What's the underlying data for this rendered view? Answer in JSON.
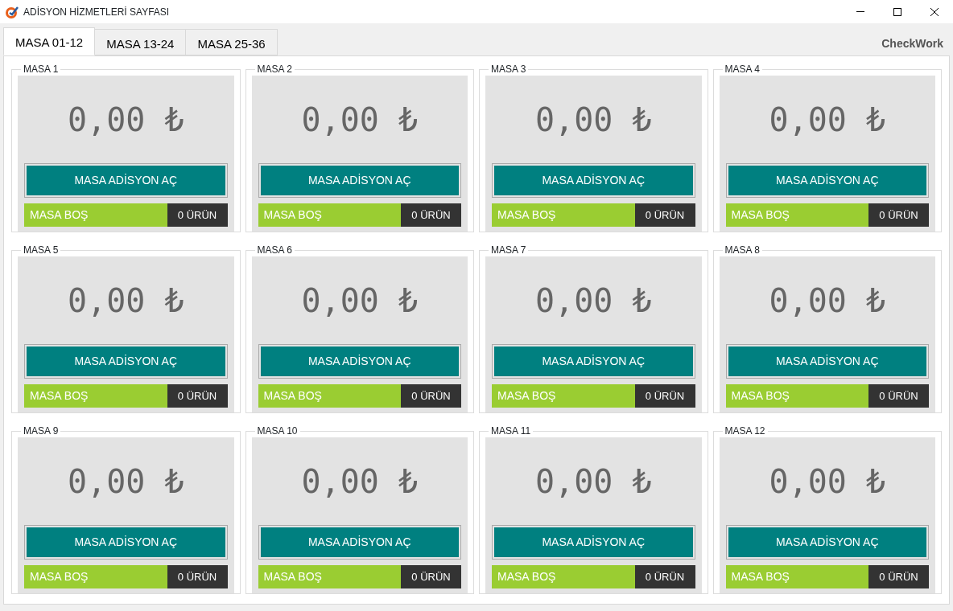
{
  "window": {
    "title": "ADİSYON HİZMETLERİ SAYFASI"
  },
  "tabs": [
    {
      "label": "MASA 01-12",
      "selected": true
    },
    {
      "label": "MASA 13-24",
      "selected": false
    },
    {
      "label": "MASA 25-36",
      "selected": false
    }
  ],
  "brand": "CheckWork",
  "tables": [
    {
      "title": "MASA 1",
      "amount": "0,00 ₺",
      "button": "MASA ADİSYON AÇ",
      "status": "MASA BOŞ",
      "items": "0 ÜRÜN"
    },
    {
      "title": "MASA 2",
      "amount": "0,00 ₺",
      "button": "MASA ADİSYON AÇ",
      "status": "MASA BOŞ",
      "items": "0 ÜRÜN"
    },
    {
      "title": "MASA 3",
      "amount": "0,00 ₺",
      "button": "MASA ADİSYON AÇ",
      "status": "MASA BOŞ",
      "items": "0 ÜRÜN"
    },
    {
      "title": "MASA 4",
      "amount": "0,00 ₺",
      "button": "MASA ADİSYON AÇ",
      "status": "MASA BOŞ",
      "items": "0 ÜRÜN"
    },
    {
      "title": "MASA 5",
      "amount": "0,00 ₺",
      "button": "MASA ADİSYON AÇ",
      "status": "MASA BOŞ",
      "items": "0 ÜRÜN"
    },
    {
      "title": "MASA 6",
      "amount": "0,00 ₺",
      "button": "MASA ADİSYON AÇ",
      "status": "MASA BOŞ",
      "items": "0 ÜRÜN"
    },
    {
      "title": "MASA 7",
      "amount": "0,00 ₺",
      "button": "MASA ADİSYON AÇ",
      "status": "MASA BOŞ",
      "items": "0 ÜRÜN"
    },
    {
      "title": "MASA 8",
      "amount": "0,00 ₺",
      "button": "MASA ADİSYON AÇ",
      "status": "MASA BOŞ",
      "items": "0 ÜRÜN"
    },
    {
      "title": "MASA 9",
      "amount": "0,00 ₺",
      "button": "MASA ADİSYON AÇ",
      "status": "MASA BOŞ",
      "items": "0 ÜRÜN"
    },
    {
      "title": "MASA 10",
      "amount": "0,00 ₺",
      "button": "MASA ADİSYON AÇ",
      "status": "MASA BOŞ",
      "items": "0 ÜRÜN"
    },
    {
      "title": "MASA 11",
      "amount": "0,00 ₺",
      "button": "MASA ADİSYON AÇ",
      "status": "MASA BOŞ",
      "items": "0 ÜRÜN"
    },
    {
      "title": "MASA 12",
      "amount": "0,00 ₺",
      "button": "MASA ADİSYON AÇ",
      "status": "MASA BOŞ",
      "items": "0 ÜRÜN"
    }
  ]
}
